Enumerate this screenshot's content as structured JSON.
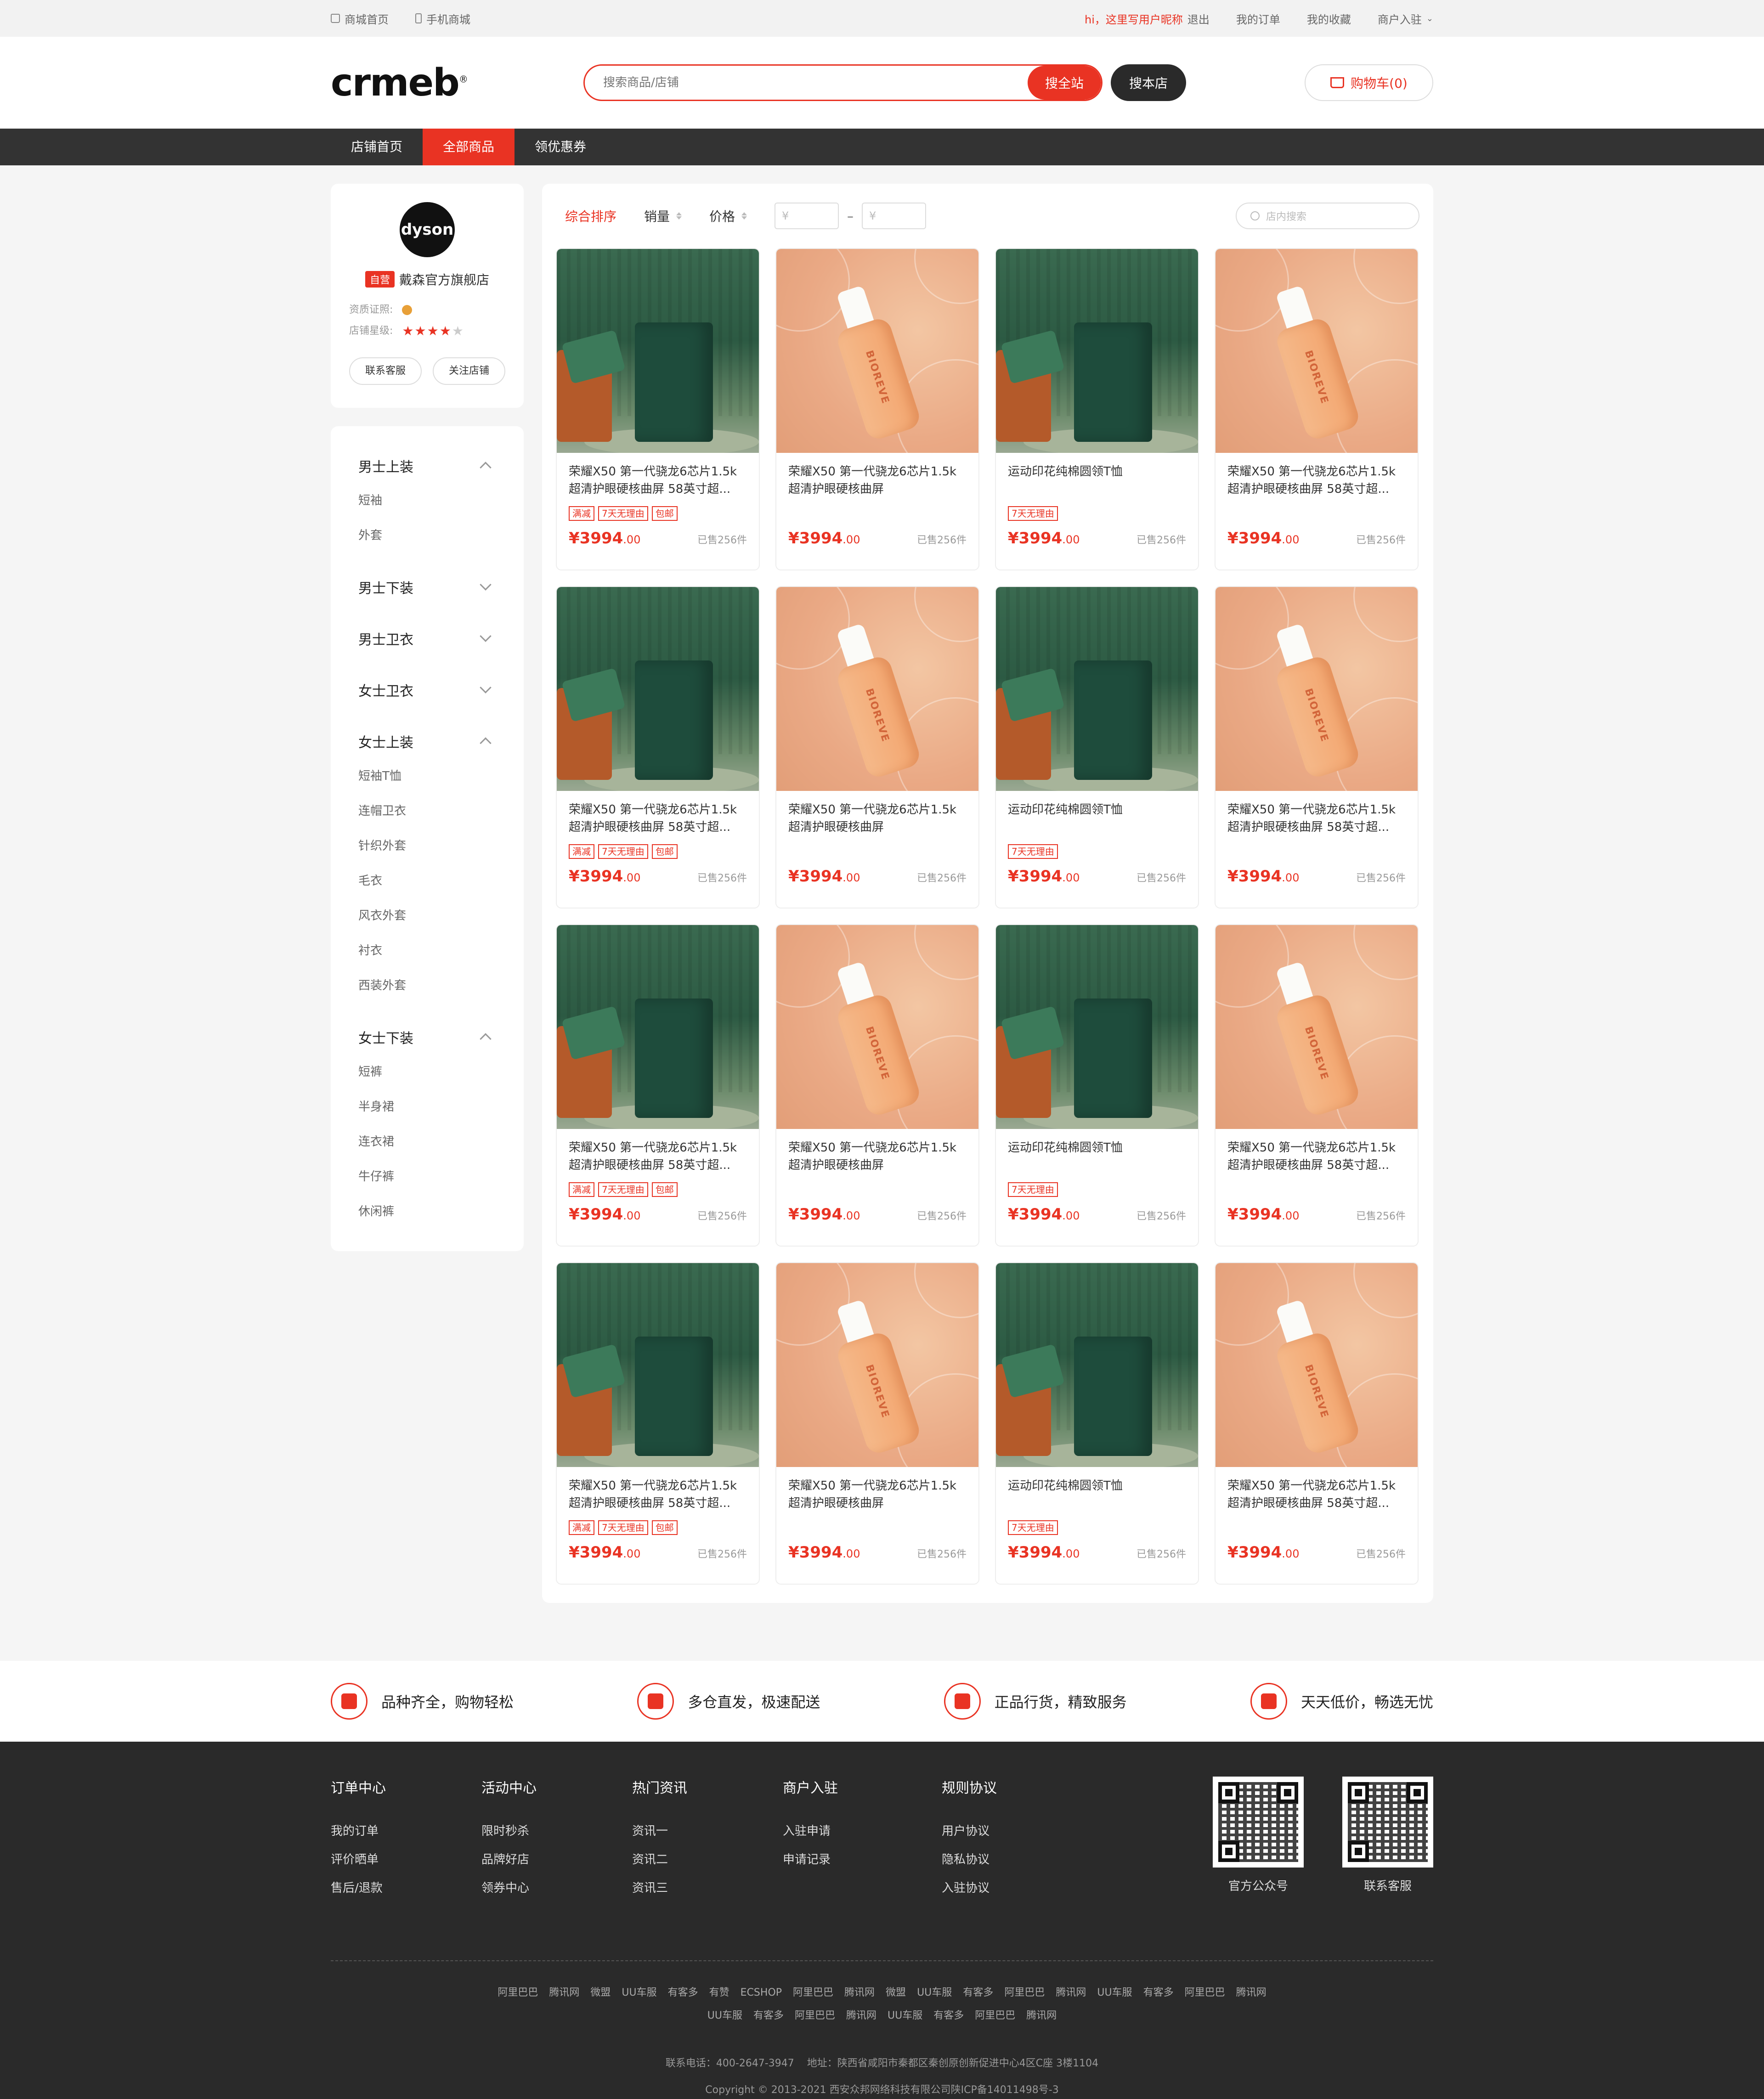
{
  "topbar": {
    "mall_home": "商城首页",
    "mobile_mall": "手机商城",
    "greeting": "hi，这里写用户昵称",
    "logout": "退出",
    "my_orders": "我的订单",
    "my_favorites": "我的收藏",
    "merchant_join": "商户入驻"
  },
  "header": {
    "logo": "crmeb",
    "search_placeholder": "搜索商品/店铺",
    "search_site": "搜全站",
    "search_store": "搜本店",
    "cart": "购物车(0)"
  },
  "nav": [
    "店铺首页",
    "全部商品",
    "领优惠券"
  ],
  "store": {
    "logo_text": "dyson",
    "badge": "自营",
    "name": "戴森官方旗舰店",
    "cert_label": "资质证照:",
    "rating_label": "店铺星级:",
    "rating": 4,
    "rating_max": 5,
    "contact": "联系客服",
    "follow": "关注店铺"
  },
  "categories": [
    {
      "title": "男士上装",
      "open": true,
      "subs": [
        "短袖",
        "外套"
      ]
    },
    {
      "title": "男士下装",
      "open": false,
      "subs": []
    },
    {
      "title": "男士卫衣",
      "open": false,
      "subs": []
    },
    {
      "title": "女士卫衣",
      "open": false,
      "subs": []
    },
    {
      "title": "女士上装",
      "open": true,
      "subs": [
        "短袖T恤",
        "连帽卫衣",
        "针织外套",
        "毛衣",
        "风衣外套",
        "衬衣",
        "西装外套"
      ]
    },
    {
      "title": "女士下装",
      "open": true,
      "subs": [
        "短裤",
        "半身裙",
        "连衣裙",
        "牛仔裤",
        "休闲裤"
      ]
    }
  ],
  "sort": {
    "default": "综合排序",
    "sales": "销量",
    "price": "价格",
    "price_min_placeholder": "¥",
    "price_max_placeholder": "¥",
    "dash": "–",
    "in_store_search": "店内搜索"
  },
  "product_types": [
    {
      "image": "green",
      "title": "荣耀X50 第一代骁龙6芯片1.5k超清护眼硬核曲屏 58英寸超...",
      "tags": [
        "满减",
        "7天无理由",
        "包邮"
      ]
    },
    {
      "image": "peach",
      "title": "荣耀X50 第一代骁龙6芯片1.5k超清护眼硬核曲屏",
      "tags": []
    },
    {
      "image": "green",
      "title": "运动印花纯棉圆领T恤",
      "tags": [
        "7天无理由"
      ]
    },
    {
      "image": "peach",
      "title": "荣耀X50 第一代骁龙6芯片1.5k超清护眼硬核曲屏 58英寸超...",
      "tags": []
    }
  ],
  "product_rows": 4,
  "product_common": {
    "price_int": "¥3994",
    "price_dec": ".00",
    "sold": "已售256件",
    "bottle_label": "BIOREVE"
  },
  "features": [
    "品种齐全，购物轻松",
    "多仓直发，极速配送",
    "正品行货，精致服务",
    "天天低价，畅选无忧"
  ],
  "footer": {
    "columns": [
      {
        "title": "订单中心",
        "items": [
          "我的订单",
          "评价晒单",
          "售后/退款"
        ]
      },
      {
        "title": "活动中心",
        "items": [
          "限时秒杀",
          "品牌好店",
          "领券中心"
        ]
      },
      {
        "title": "热门资讯",
        "items": [
          "资讯一",
          "资讯二",
          "资讯三"
        ]
      },
      {
        "title": "商户入驻",
        "items": [
          "入驻申请",
          "申请记录"
        ]
      },
      {
        "title": "规则协议",
        "items": [
          "用户协议",
          "隐私协议",
          "入驻协议"
        ]
      }
    ],
    "qrcodes": [
      "官方公众号",
      "联系客服"
    ],
    "links_row1": [
      "阿里巴巴",
      "腾讯网",
      "微盟",
      "UU车服",
      "有客多",
      "有赞",
      "ECSHOP",
      "阿里巴巴",
      "腾讯网",
      "微盟",
      "UU车服",
      "有客多",
      "阿里巴巴",
      "腾讯网",
      "UU车服",
      "有客多",
      "阿里巴巴",
      "腾讯网"
    ],
    "links_row2": [
      "UU车服",
      "有客多",
      "阿里巴巴",
      "腾讯网",
      "UU车服",
      "有客多",
      "阿里巴巴",
      "腾讯网"
    ],
    "phone": "联系电话：400-2647-3947",
    "address": "地址：陕西省咸阳市秦都区秦创原创新促进中心4区C座 3楼1104",
    "copyright": "Copyright © 2013-2021 西安众邦网络科技有限公司陕ICP备14011498号-3"
  }
}
